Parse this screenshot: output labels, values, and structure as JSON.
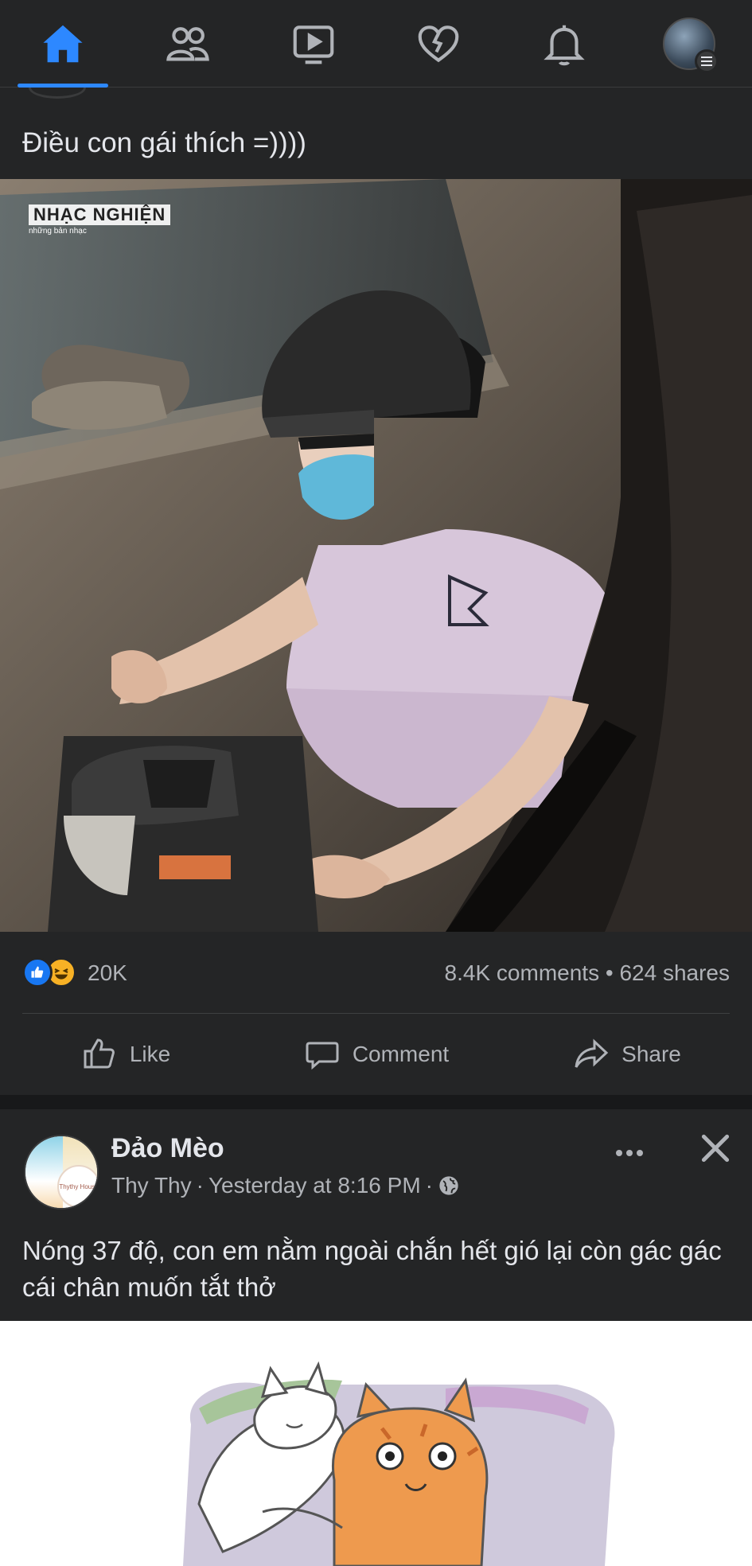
{
  "nav": {
    "items": [
      {
        "name": "home",
        "icon": "home-icon",
        "active": true
      },
      {
        "name": "friends",
        "icon": "friends-icon",
        "active": false
      },
      {
        "name": "watch",
        "icon": "video-icon",
        "active": false
      },
      {
        "name": "dating",
        "icon": "heart-icon",
        "active": false
      },
      {
        "name": "notifications",
        "icon": "bell-icon",
        "active": false
      },
      {
        "name": "menu",
        "icon": "profile-avatar",
        "active": false
      }
    ],
    "accent_color": "#2d88ff"
  },
  "post1": {
    "text": "Điều con gái thích =))))",
    "watermark": "NHẠC NGHIỆN",
    "watermark_sub": "những bản nhạc",
    "reaction_count": "20K",
    "comments": "8.4K comments",
    "shares": "624 shares",
    "separator": "•",
    "actions": {
      "like": "Like",
      "comment": "Comment",
      "share": "Share"
    }
  },
  "post2": {
    "page_name": "Đảo Mèo",
    "author": "Thy Thy",
    "time": "Yesterday at 8:16 PM",
    "meta_sep": "·",
    "avatar_text": "Thythy House",
    "text": "Nóng 37 độ, con em nằm ngoài chắn hết gió lại còn gác gác cái chân muốn tắt thở"
  },
  "colors": {
    "background": "#18191a",
    "card": "#242526",
    "text_primary": "#e4e6eb",
    "text_secondary": "#b0b3b8",
    "like_blue": "#1877f2"
  }
}
